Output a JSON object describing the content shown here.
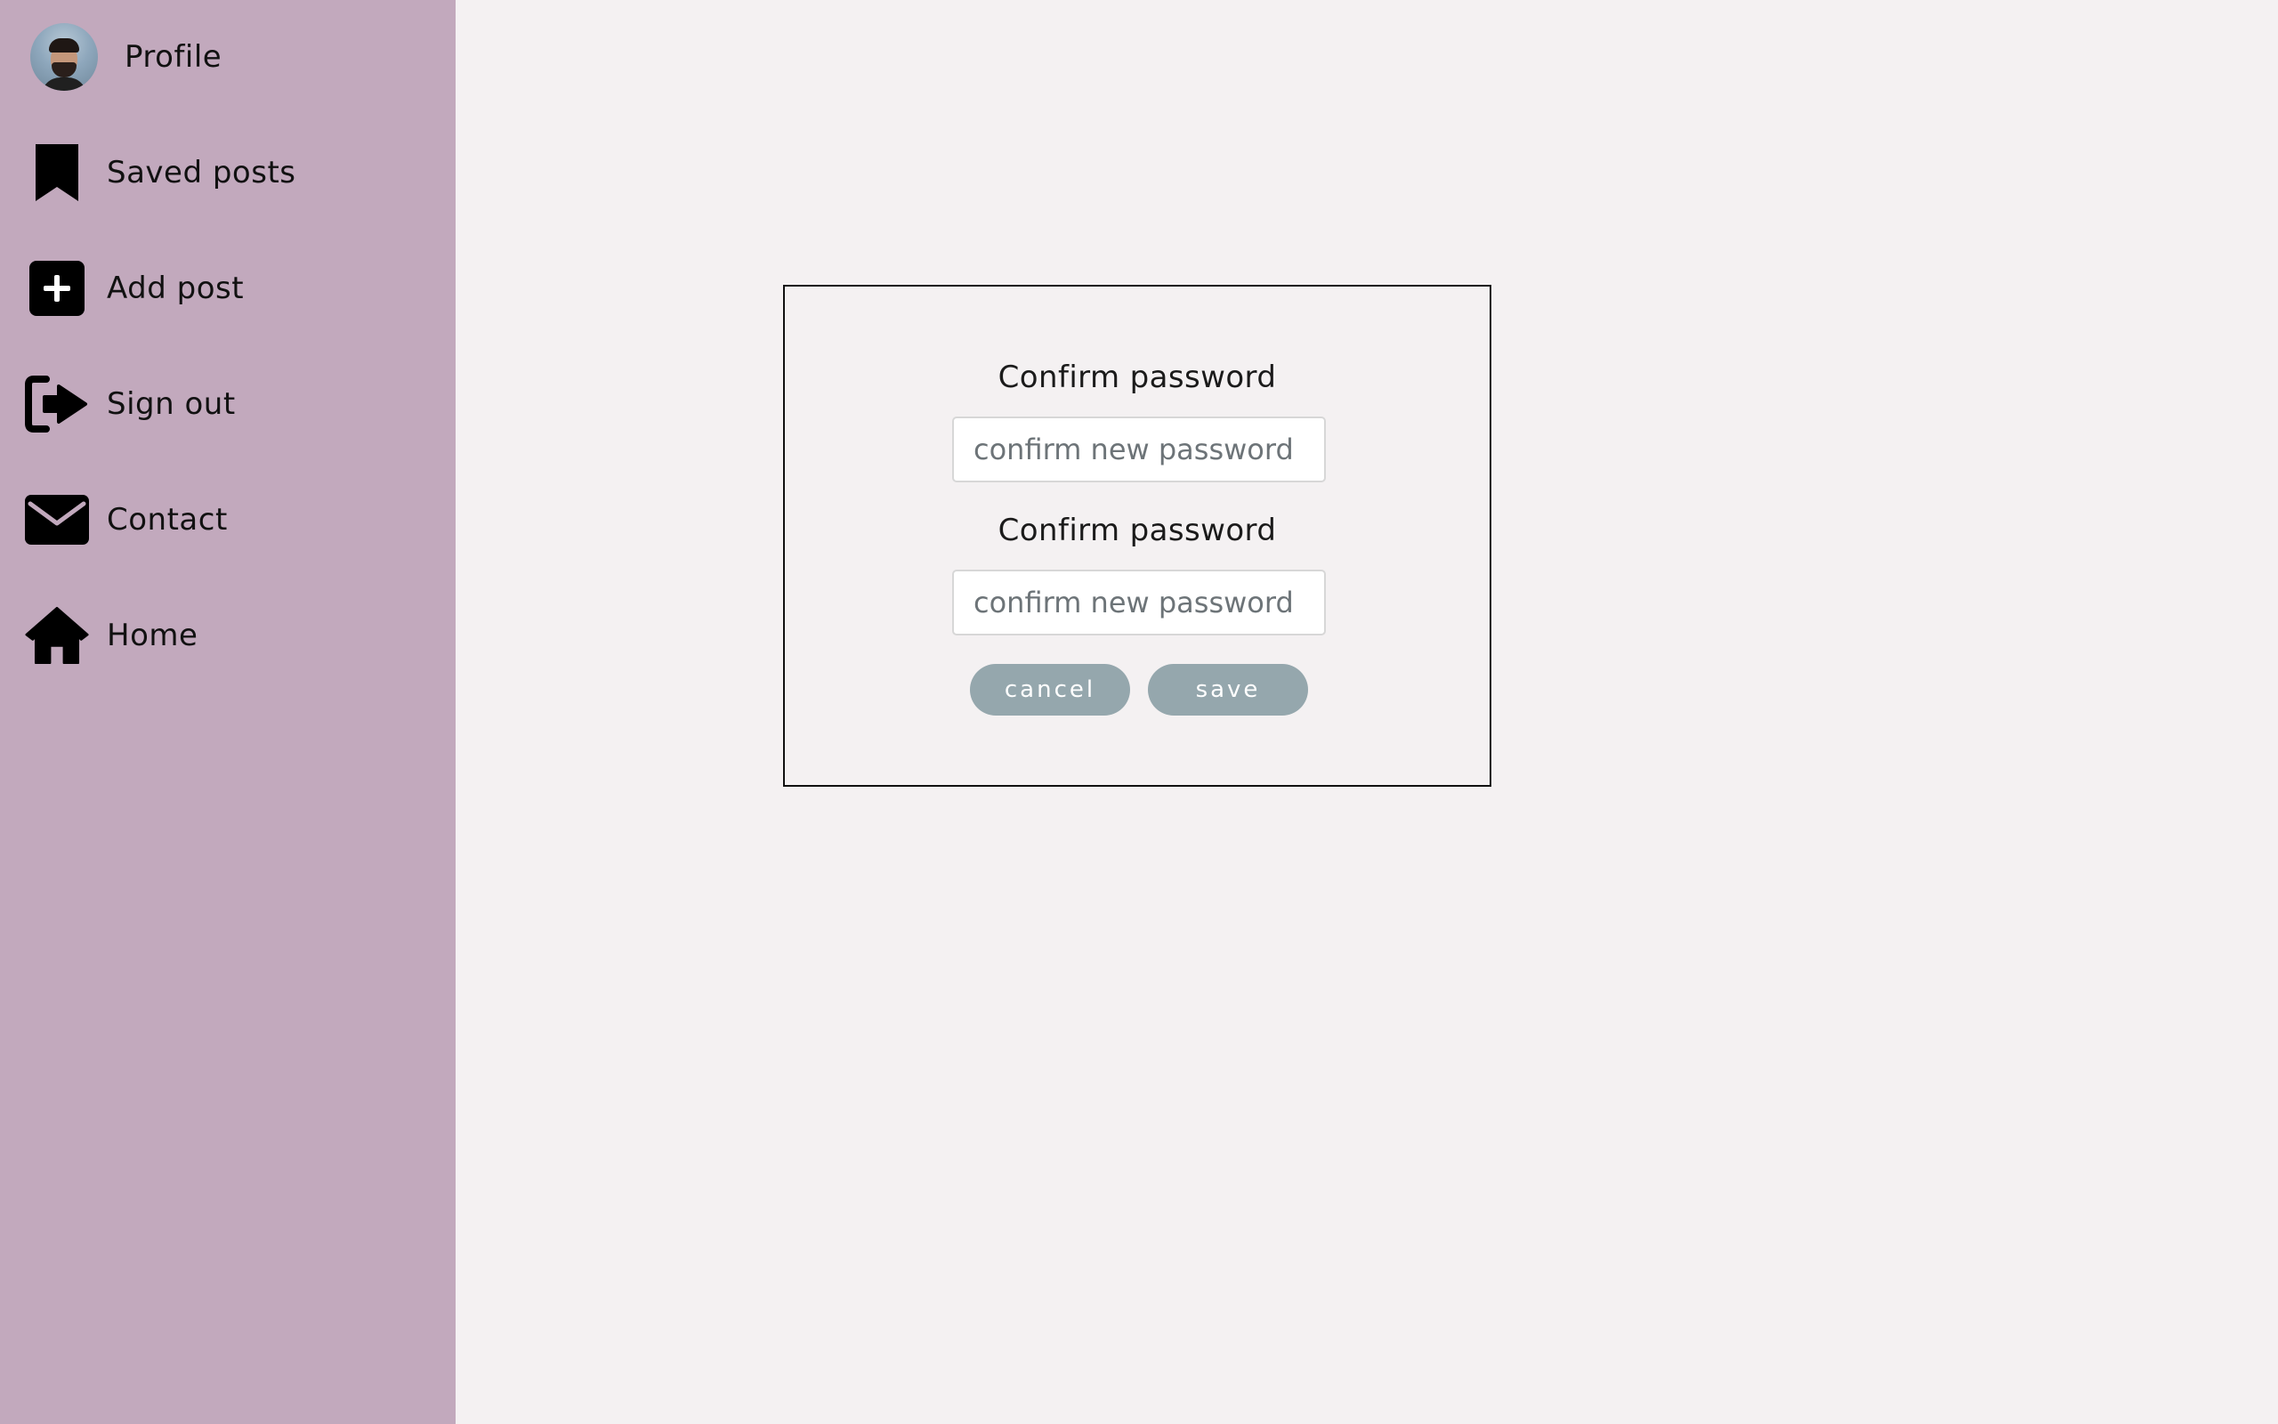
{
  "sidebar": {
    "background_color": "#c2a9bd",
    "items": [
      {
        "label": "Profile",
        "icon": "avatar-photo"
      },
      {
        "label": "Saved posts",
        "icon": "bookmark-icon"
      },
      {
        "label": "Add post",
        "icon": "plus-square-icon"
      },
      {
        "label": "Sign out",
        "icon": "sign-out-icon"
      },
      {
        "label": "Contact",
        "icon": "envelope-icon"
      },
      {
        "label": "Home",
        "icon": "home-icon"
      }
    ]
  },
  "modal": {
    "fields": [
      {
        "label": "Confirm password",
        "placeholder": "confirm new password",
        "value": ""
      },
      {
        "label": "Confirm password",
        "placeholder": "confirm new password",
        "value": ""
      }
    ],
    "cancel_label": "cancel",
    "save_label": "save",
    "button_color": "#95a7ad"
  },
  "colors": {
    "page_background": "#f4f1f2",
    "text": "#111111"
  }
}
